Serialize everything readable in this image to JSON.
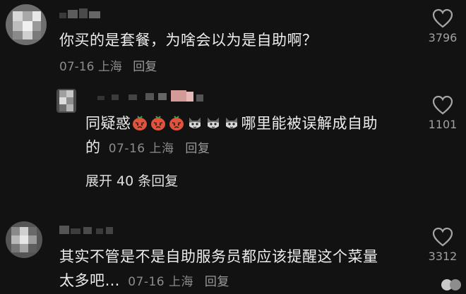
{
  "comments": [
    {
      "text_lines": [
        "你买的是套餐，为啥会以为是自助啊？"
      ],
      "date": "07-16",
      "location": "上海",
      "reply_label": "回复",
      "likes": "3796",
      "like_icon": "heart-outline-icon"
    },
    {
      "text_before_emoji": "同疑惑",
      "emoji_names": [
        "angry-tomato-emoji",
        "angry-tomato-emoji",
        "angry-tomato-emoji",
        "cat-emoji",
        "cat-emoji",
        "cat-emoji"
      ],
      "text_after_emoji": "哪里能被误解成自助",
      "text_line2": "的",
      "date": "07-16",
      "location": "上海",
      "reply_label": "回复",
      "likes": "1101",
      "like_icon": "heart-outline-icon"
    },
    {
      "text_lines": [
        "其实不管是不是自助服务员都应该提醒这个菜量",
        "太多吧…"
      ],
      "date": "07-16",
      "location": "上海",
      "reply_label": "回复",
      "likes": "3312",
      "like_icon": "heart-outline-icon"
    }
  ],
  "expand_replies_label": "展开 40 条回复",
  "colors": {
    "background": "#121212",
    "text": "#ececec",
    "meta": "#8c8c8c"
  }
}
